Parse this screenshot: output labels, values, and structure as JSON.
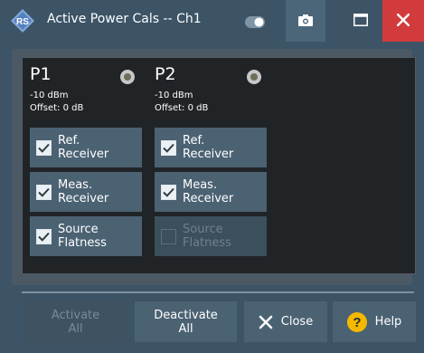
{
  "window": {
    "title": "Active Power Cals -- Ch1",
    "icons": [
      "logo-icon",
      "toggle-icon",
      "camera-icon",
      "maximize-icon",
      "close-icon"
    ]
  },
  "ports": [
    {
      "name": "P1",
      "level": "-10 dBm",
      "offset": "Offset: 0 dB",
      "cals": [
        {
          "label_1": "Ref.",
          "label_2": "Receiver",
          "checked": true,
          "enabled": true
        },
        {
          "label_1": "Meas.",
          "label_2": "Receiver",
          "checked": true,
          "enabled": true
        },
        {
          "label_1": "Source",
          "label_2": "Flatness",
          "checked": true,
          "enabled": true
        }
      ]
    },
    {
      "name": "P2",
      "level": "-10 dBm",
      "offset": "Offset: 0 dB",
      "cals": [
        {
          "label_1": "Ref.",
          "label_2": "Receiver",
          "checked": true,
          "enabled": true
        },
        {
          "label_1": "Meas.",
          "label_2": "Receiver",
          "checked": true,
          "enabled": true
        },
        {
          "label_1": "Source",
          "label_2": "Flatness",
          "checked": false,
          "enabled": false
        }
      ]
    }
  ],
  "buttons": {
    "activate_1": "Activate",
    "activate_2": "All",
    "deactivate_1": "Deactivate",
    "deactivate_2": "All",
    "close": "Close",
    "help": "Help"
  },
  "colors": {
    "titlebar": "#3c5466",
    "close_red": "#d23b3b",
    "button": "#4b6273",
    "help_yellow": "#f5b800"
  }
}
